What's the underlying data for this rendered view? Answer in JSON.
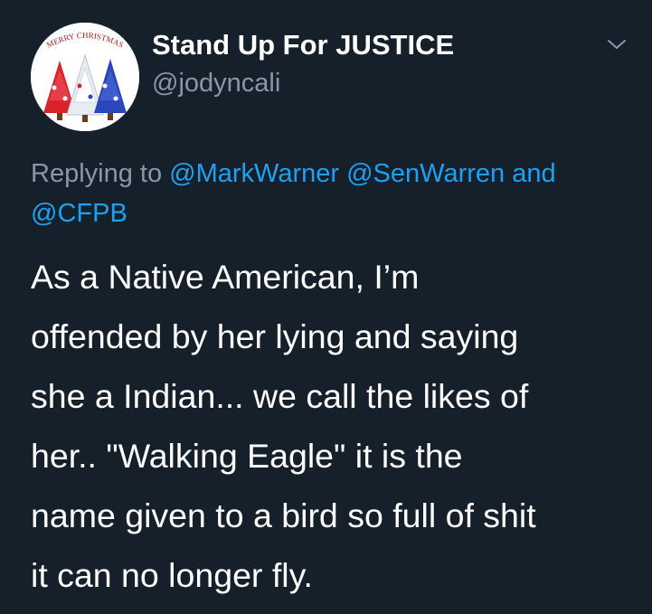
{
  "tweet": {
    "author": {
      "display_name": "Stand Up For JUSTICE",
      "handle": "@jodyncali",
      "avatar_text": "MERRY CHRISTMAS"
    },
    "menu_icon": "chevron-down-icon",
    "reply": {
      "prefix": "Replying to",
      "mentions": [
        "@MarkWarner",
        "@SenWarren"
      ],
      "conjunction": "and",
      "last_mention": "@CFPB"
    },
    "body_lines": [
      "As a Native American, I’m",
      "offended by her lying and saying",
      "she a Indian... we call the likes of",
      "her.. \"Walking Eagle\" it is the",
      "name given to a bird so full of shit",
      "it can no longer fly."
    ]
  },
  "colors": {
    "background": "#15202b",
    "text": "#ffffff",
    "secondary": "#8899a6",
    "link": "#1da1f2"
  }
}
